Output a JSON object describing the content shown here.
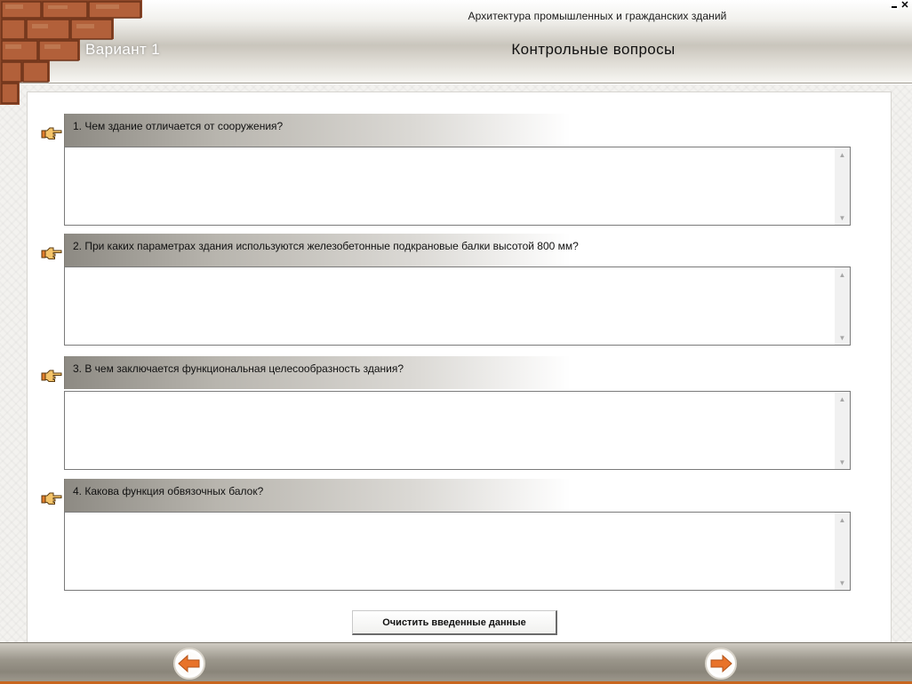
{
  "header": {
    "course_title": "Архитектура промышленных и гражданских зданий",
    "variant": "Вариант 1",
    "page_title": "Контрольные вопросы"
  },
  "window_controls": {
    "minimize_icon": "minimize-icon",
    "close_icon": "close-icon",
    "close_symbol": "✕"
  },
  "questions": [
    {
      "text": "1. Чем здание отличается от сооружения?",
      "answer": ""
    },
    {
      "text": "2. При каких параметрах здания используются железобетонные подкрановые балки высотой 800 мм?",
      "answer": ""
    },
    {
      "text": "3. В чем заключается функциональная целесообразность здания?",
      "answer": ""
    },
    {
      "text": "4. Какова функция обвязочных балок?",
      "answer": ""
    }
  ],
  "clear_button_label": "Очистить введенные данные",
  "icons": {
    "question_marker": "pointing-hand-icon",
    "prev": "arrow-left-icon",
    "next": "arrow-right-icon"
  },
  "colors": {
    "accent_orange": "#e8732a",
    "footer_line": "#c8661f",
    "question_bar": "#8d8a83"
  }
}
